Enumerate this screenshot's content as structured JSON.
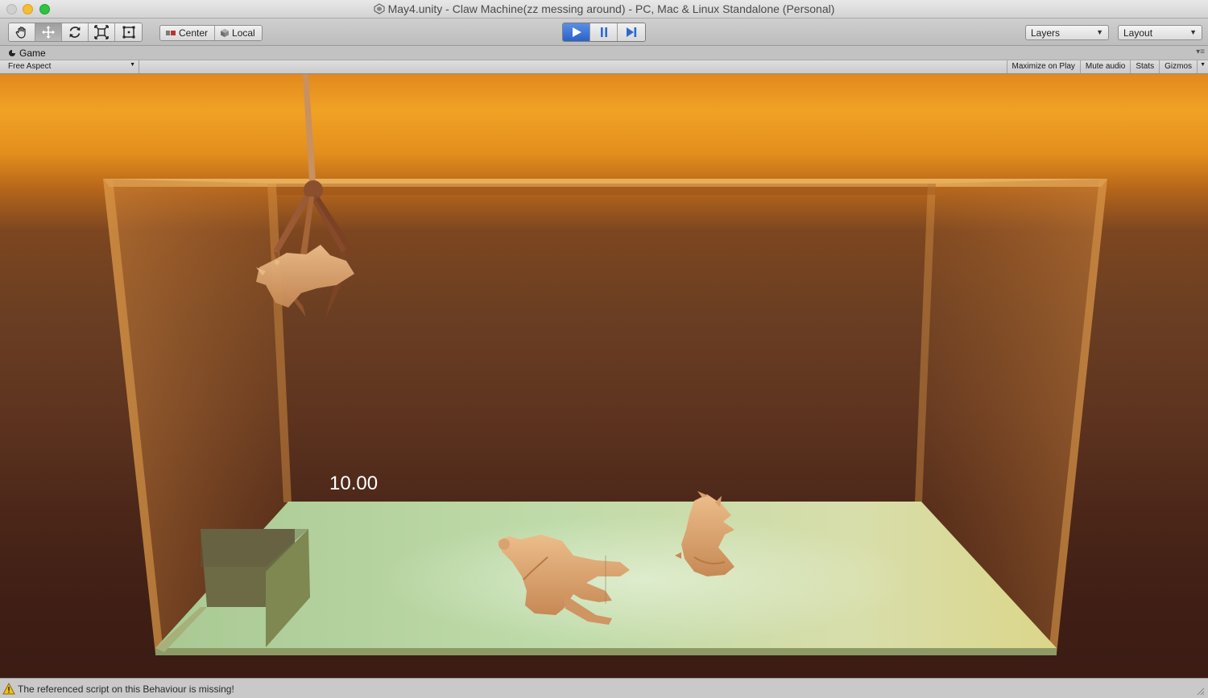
{
  "window": {
    "title": "May4.unity - Claw Machine(zz messing around) - PC, Mac & Linux Standalone (Personal)"
  },
  "toolbar": {
    "tools": [
      "hand-tool",
      "move-tool",
      "rotate-tool",
      "scale-tool",
      "rect-tool"
    ],
    "active_tool": "move-tool",
    "pivot_mode_label": "Center",
    "pivot_rotation_label": "Local",
    "play_active": true,
    "layers_label": "Layers",
    "layout_label": "Layout"
  },
  "game_view": {
    "tab_label": "Game",
    "aspect_label": "Free Aspect",
    "maximize_on_play_label": "Maximize on Play",
    "mute_audio_label": "Mute audio",
    "stats_label": "Stats",
    "gizmos_label": "Gizmos",
    "timer_value": "10.00"
  },
  "status": {
    "message": "The referenced script on this Behaviour is missing!"
  },
  "colors": {
    "sky_top": "#f0a225",
    "tank_back": "#5f3520",
    "floor": "#b7d6a3",
    "play_accent": "#2a62c8",
    "model_tone": "#d7a06d"
  }
}
